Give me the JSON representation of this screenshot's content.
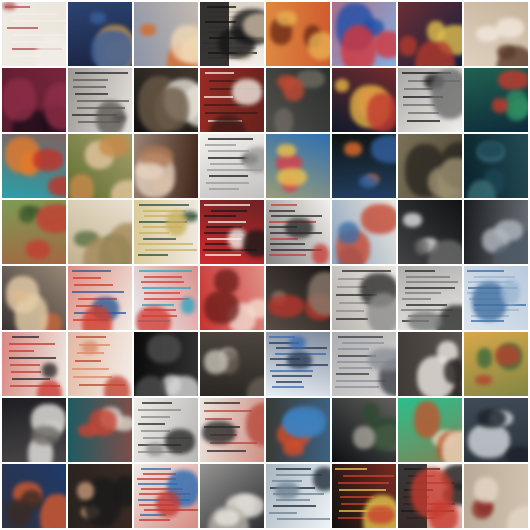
{
  "grid": {
    "rows": 8,
    "cols": 8
  },
  "palette": {
    "white": "#f4f1ec",
    "cream": "#e8ddc8",
    "black": "#0e0c0d",
    "navy": "#1c2a52",
    "red": "#c8342c",
    "orange": "#d9782e",
    "teal": "#2f8f8a",
    "green": "#4f7d3a",
    "blue": "#3b64b8",
    "brown": "#6b4a33",
    "gray": "#8a8a88",
    "yellow": "#d8c04a"
  },
  "tiles": [
    {
      "bg": "#ece6dd",
      "c1": "#b34d52",
      "c2": "#f2efe8",
      "style": "doc"
    },
    {
      "bg": "#1a2340",
      "c1": "#d29a4a",
      "c2": "#3a5f9c",
      "style": "art"
    },
    {
      "bg": "#8c94a8",
      "c1": "#d66a2b",
      "c2": "#f0d8b5",
      "style": "art"
    },
    {
      "bg": "#f1efea",
      "c1": "#151515",
      "c2": "#c9b7a2",
      "style": "split"
    },
    {
      "bg": "#cf5b2d",
      "c1": "#6d2a16",
      "c2": "#e9b052",
      "style": "art"
    },
    {
      "bg": "#7fb0e2",
      "c1": "#1f4fa8",
      "c2": "#d4363c",
      "style": "art"
    },
    {
      "bg": "#14203d",
      "c1": "#e0c04f",
      "c2": "#b33a2d",
      "style": "art"
    },
    {
      "bg": "#c7b39b",
      "c1": "#5a3a2a",
      "c2": "#f2e9de",
      "style": "art"
    },
    {
      "bg": "#5a1b2e",
      "c1": "#1d0e19",
      "c2": "#8f2e48",
      "style": "dark"
    },
    {
      "bg": "#e5e2de",
      "c1": "#2b2b2b",
      "c2": "#5e5a55",
      "style": "doc"
    },
    {
      "bg": "#101010",
      "c1": "#e7e2d8",
      "c2": "#6b5a48",
      "style": "dark"
    },
    {
      "bg": "#9a2a24",
      "c1": "#f1ebe2",
      "c2": "#3d1b17",
      "style": "doc"
    },
    {
      "bg": "#2c2f2d",
      "c1": "#c24a33",
      "c2": "#6e6a62",
      "style": "dark"
    },
    {
      "bg": "#0f1a2b",
      "c1": "#e6b447",
      "c2": "#c23931",
      "style": "art"
    },
    {
      "bg": "#f0eeea",
      "c1": "#1b1b1b",
      "c2": "#6b6b6b",
      "style": "doc"
    },
    {
      "bg": "#0e2a3a",
      "c1": "#c63a2e",
      "c2": "#2f8e63",
      "style": "art"
    },
    {
      "bg": "#28a0a8",
      "c1": "#e57a2a",
      "c2": "#c33026",
      "style": "art"
    },
    {
      "bg": "#5d6e2f",
      "c1": "#c98a4a",
      "c2": "#e4c6a0",
      "style": "art"
    },
    {
      "bg": "#3d2418",
      "c1": "#b07a56",
      "c2": "#e6d2bf",
      "style": "art"
    },
    {
      "bg": "#f4f1ee",
      "c1": "#1d1d1d",
      "c2": "#9a9a9a",
      "style": "light"
    },
    {
      "bg": "#2f6fb1",
      "c1": "#d93d4b",
      "c2": "#f0c14a",
      "style": "art"
    },
    {
      "bg": "#0f1411",
      "c1": "#e46d2c",
      "c2": "#3262a4",
      "style": "dark"
    },
    {
      "bg": "#524a38",
      "c1": "#2a2620",
      "c2": "#9b8f71",
      "style": "dark"
    },
    {
      "bg": "#08212a",
      "c1": "#1b4654",
      "c2": "#3c6f78",
      "style": "dark"
    },
    {
      "bg": "#7c9b54",
      "c1": "#3c5a2c",
      "c2": "#c43d32",
      "style": "art"
    },
    {
      "bg": "#e9e0cf",
      "c1": "#5a6f42",
      "c2": "#a38a5a",
      "style": "art"
    },
    {
      "bg": "#efe9df",
      "c1": "#2b4f3e",
      "c2": "#c9b15e",
      "style": "doc"
    },
    {
      "bg": "#d22a2d",
      "c1": "#f4f0ea",
      "c2": "#1a1a1a",
      "style": "doc"
    },
    {
      "bg": "#f3f0ec",
      "c1": "#c73e39",
      "c2": "#2c2c2c",
      "style": "doc"
    },
    {
      "bg": "#ece7de",
      "c1": "#c54933",
      "c2": "#3d6fa6",
      "style": "art"
    },
    {
      "bg": "#101214",
      "c1": "#e2e2e2",
      "c2": "#6b6b6b",
      "style": "dark"
    },
    {
      "bg": "#191b1f",
      "c1": "#4e5a66",
      "c2": "#b2b8c0",
      "style": "dark"
    },
    {
      "bg": "#3a3234",
      "c1": "#c9673a",
      "c2": "#e5cfa9",
      "style": "art"
    },
    {
      "bg": "#f0ece6",
      "c1": "#2d5a98",
      "c2": "#d23c2c",
      "style": "doc"
    },
    {
      "bg": "#e9f2f4",
      "c1": "#2ea6c4",
      "c2": "#d33f37",
      "style": "doc"
    },
    {
      "bg": "#c8322e",
      "c1": "#6e1e1b",
      "c2": "#f3dcd0",
      "style": "art"
    },
    {
      "bg": "#1b1716",
      "c1": "#b8352c",
      "c2": "#8a7a6c",
      "style": "dark"
    },
    {
      "bg": "#ebe6df",
      "c1": "#2c2c2c",
      "c2": "#8d8d8d",
      "style": "doc"
    },
    {
      "bg": "#ecebe8",
      "c1": "#2a2a2a",
      "c2": "#7a7a7a",
      "style": "light"
    },
    {
      "bg": "#dde4ec",
      "c1": "#3f6ea1",
      "c2": "#9ab6d2",
      "style": "light"
    },
    {
      "bg": "#ede8e2",
      "c1": "#2a2a2a",
      "c2": "#c83a32",
      "style": "doc"
    },
    {
      "bg": "#f3efea",
      "c1": "#c24432",
      "c2": "#d98b6a",
      "style": "light"
    },
    {
      "bg": "#0b0b0c",
      "c1": "#d7d7d7",
      "c2": "#4e4e4e",
      "style": "dark"
    },
    {
      "bg": "#2a2622",
      "c1": "#c8c3b8",
      "c2": "#6a6158",
      "style": "dark"
    },
    {
      "bg": "#e8eef5",
      "c1": "#3a6cb0",
      "c2": "#2a3a54",
      "style": "light"
    },
    {
      "bg": "#d8d5d2",
      "c1": "#3c3f46",
      "c2": "#8b8f98",
      "style": "light"
    },
    {
      "bg": "#5a5450",
      "c1": "#efeae4",
      "c2": "#2a2522",
      "style": "dark"
    },
    {
      "bg": "#d8a84a",
      "c1": "#b3422f",
      "c2": "#3b6a3c",
      "style": "art"
    },
    {
      "bg": "#1d1d22",
      "c1": "#e8e6e2",
      "c2": "#6e6a66",
      "style": "dark"
    },
    {
      "bg": "#1f5b63",
      "c1": "#ded6cb",
      "c2": "#c74535",
      "style": "art"
    },
    {
      "bg": "#f1eeea",
      "c1": "#2b2b2b",
      "c2": "#8a8a8a",
      "style": "light"
    },
    {
      "bg": "#ebe6de",
      "c1": "#2a2a2a",
      "c2": "#b74a3c",
      "style": "doc"
    },
    {
      "bg": "#3a3a36",
      "c1": "#d74d2a",
      "c2": "#3e82c0",
      "style": "art"
    },
    {
      "bg": "#0d1013",
      "c1": "#2e4a30",
      "c2": "#a7a39b",
      "style": "dark"
    },
    {
      "bg": "#2bbf8b",
      "c1": "#e9ddc5",
      "c2": "#c2542e",
      "style": "art"
    },
    {
      "bg": "#3f4a56",
      "c1": "#d7dbe0",
      "c2": "#1c222a",
      "style": "art"
    },
    {
      "bg": "#1e3a6a",
      "c1": "#d65a2e",
      "c2": "#3b2b24",
      "style": "art"
    },
    {
      "bg": "#3a2b24",
      "c1": "#c89a7a",
      "c2": "#1a1a1a",
      "style": "art"
    },
    {
      "bg": "#f0ece7",
      "c1": "#2b6cb3",
      "c2": "#c43a32",
      "style": "doc"
    },
    {
      "bg": "#2f2f33",
      "c1": "#b8b4ac",
      "c2": "#e9e6e0",
      "style": "dark"
    },
    {
      "bg": "#eef3f6",
      "c1": "#1d2a36",
      "c2": "#6f8394",
      "style": "light"
    },
    {
      "bg": "#121212",
      "c1": "#e6c84c",
      "c2": "#c8402f",
      "style": "doc"
    },
    {
      "bg": "#f3f0ec",
      "c1": "#1a1a1a",
      "c2": "#c63b2f",
      "style": "split"
    },
    {
      "bg": "#b8aa96",
      "c1": "#8c2f2a",
      "c2": "#e5d7c5",
      "style": "art"
    }
  ]
}
